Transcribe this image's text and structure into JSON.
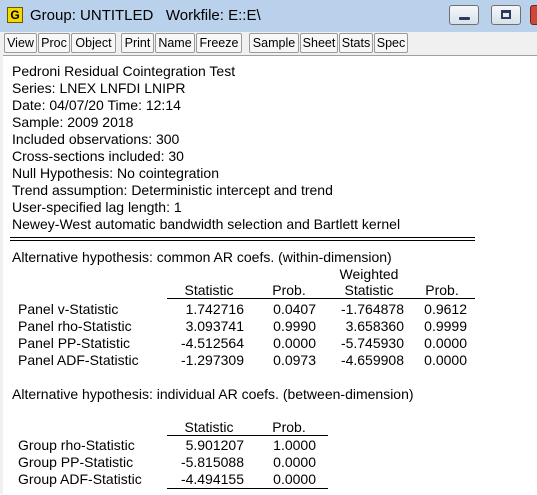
{
  "window": {
    "title": "Group: UNTITLED   Workfile: E::E\\",
    "app_icon_letter": "G"
  },
  "toolbar": [
    "View",
    "Proc",
    "Object",
    "Print",
    "Name",
    "Freeze",
    "Sample",
    "Sheet",
    "Stats",
    "Spec"
  ],
  "header_lines": [
    "Pedroni Residual Cointegration Test",
    "Series: LNEX LNFDI LNIPR",
    "Date: 04/07/20   Time: 12:14",
    "Sample: 2009 2018",
    "Included observations: 300",
    "Cross-sections included: 30",
    "Null Hypothesis: No cointegration",
    "Trend assumption: Deterministic intercept and trend",
    "User-specified lag length: 1",
    "Newey-West automatic bandwidth selection and Bartlett kernel"
  ],
  "within": {
    "title": "Alternative hypothesis: common AR coefs. (within-dimension)",
    "weighted_label": "Weighted",
    "headers": [
      "Statistic",
      "Prob.",
      "Statistic",
      "Prob."
    ],
    "rows": [
      {
        "label": "Panel v-Statistic",
        "stat": "1.742716",
        "prob": "0.0407",
        "wstat": "-1.764878",
        "wprob": "0.9612"
      },
      {
        "label": "Panel rho-Statistic",
        "stat": "3.093741",
        "prob": "0.9990",
        "wstat": "3.658360",
        "wprob": "0.9999"
      },
      {
        "label": "Panel PP-Statistic",
        "stat": "-4.512564",
        "prob": "0.0000",
        "wstat": "-5.745930",
        "wprob": "0.0000"
      },
      {
        "label": "Panel ADF-Statistic",
        "stat": "-1.297309",
        "prob": "0.0973",
        "wstat": "-4.659908",
        "wprob": "0.0000"
      }
    ]
  },
  "between": {
    "title": "Alternative hypothesis: individual AR coefs. (between-dimension)",
    "headers": [
      "Statistic",
      "Prob."
    ],
    "rows": [
      {
        "label": "Group rho-Statistic",
        "stat": "5.901207",
        "prob": "1.0000"
      },
      {
        "label": "Group PP-Statistic",
        "stat": "-5.815088",
        "prob": "0.0000"
      },
      {
        "label": "Group ADF-Statistic",
        "stat": "-4.494155",
        "prob": "0.0000"
      }
    ]
  }
}
